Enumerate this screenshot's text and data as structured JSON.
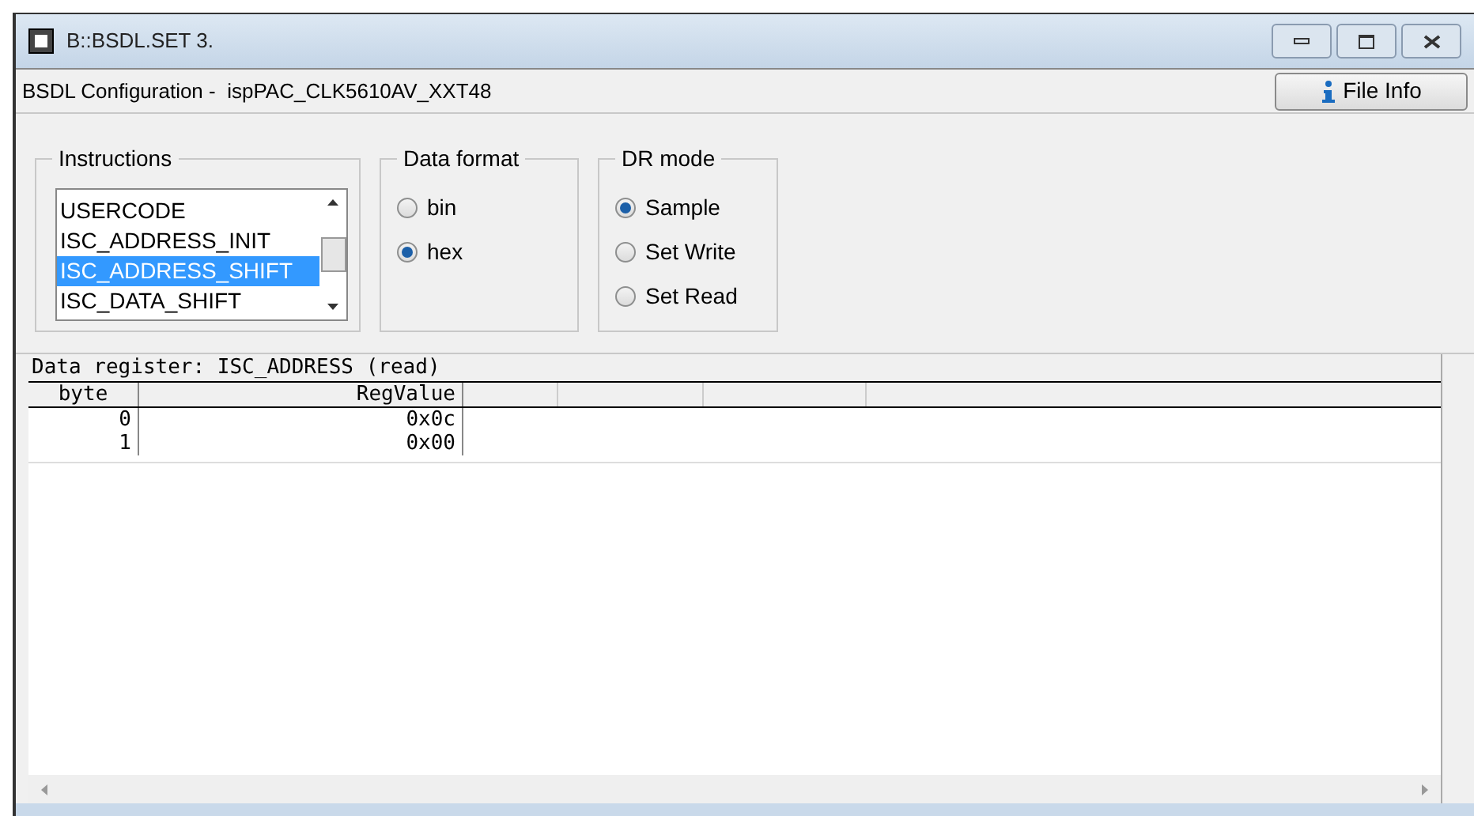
{
  "window": {
    "title": "B::BSDL.SET 3."
  },
  "header": {
    "label": "BSDL Configuration -  ispPAC_CLK5610AV_XXT48",
    "file_info_button": "File Info"
  },
  "instructions": {
    "title": "Instructions",
    "items": [
      {
        "label": "USERCODE",
        "selected": false
      },
      {
        "label": "ISC_ADDRESS_INIT",
        "selected": false
      },
      {
        "label": "ISC_ADDRESS_SHIFT",
        "selected": true
      },
      {
        "label": "ISC_DATA_SHIFT",
        "selected": false
      }
    ]
  },
  "data_format": {
    "title": "Data format",
    "options": [
      {
        "label": "bin",
        "selected": false
      },
      {
        "label": "hex",
        "selected": true
      }
    ]
  },
  "dr_mode": {
    "title": "DR mode",
    "options": [
      {
        "label": "Sample",
        "selected": true
      },
      {
        "label": "Set Write",
        "selected": false
      },
      {
        "label": "Set Read",
        "selected": false
      }
    ]
  },
  "register": {
    "title": "Data register: ISC_ADDRESS (read)",
    "columns": [
      "byte",
      "RegValue"
    ],
    "rows": [
      [
        "0",
        "0x0c"
      ],
      [
        "1",
        "0x00"
      ]
    ]
  }
}
